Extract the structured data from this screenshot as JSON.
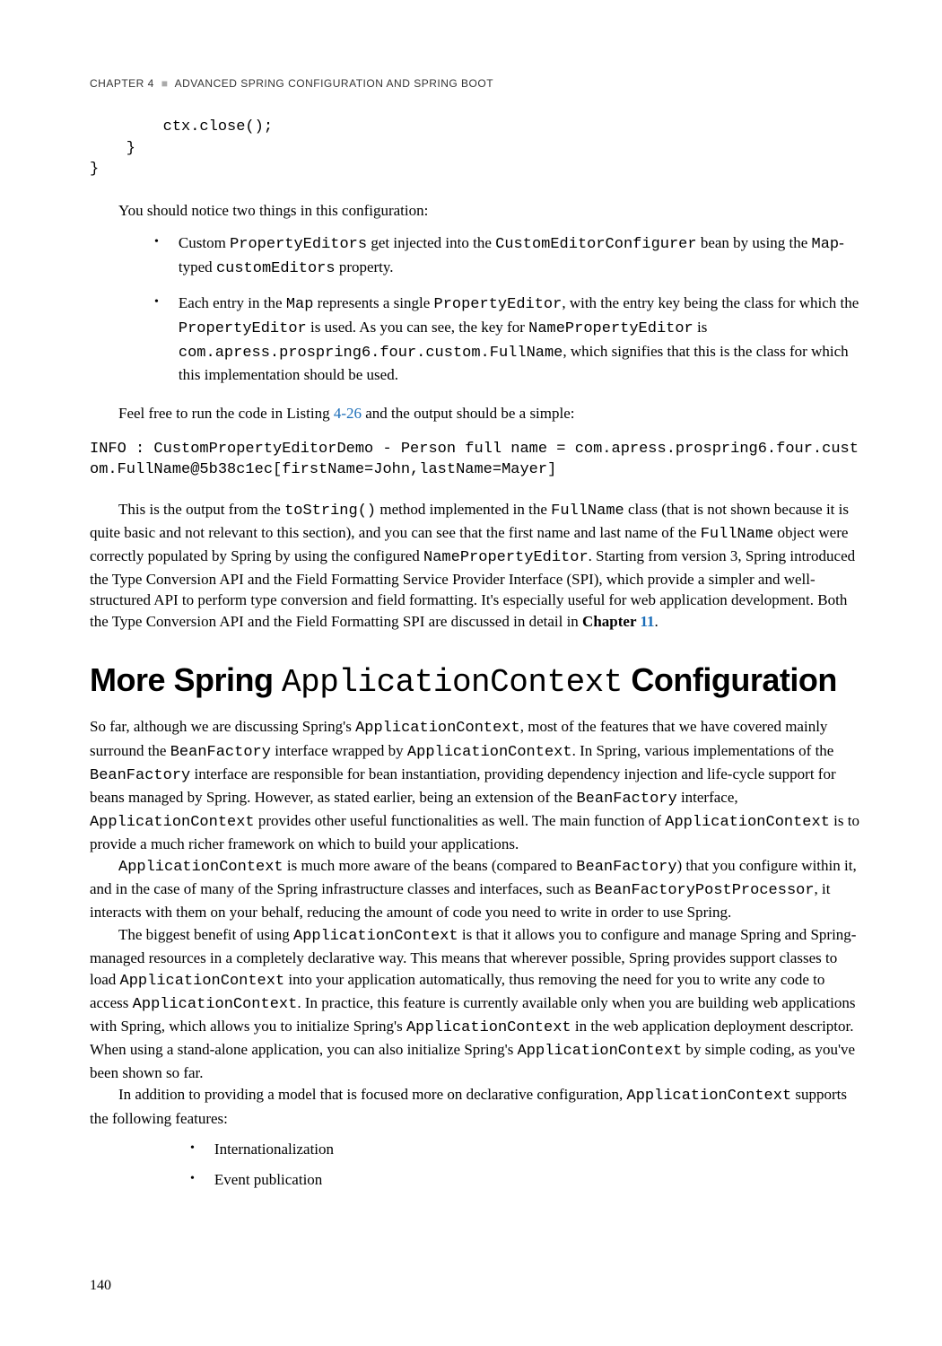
{
  "header": {
    "chapter_label": "CHAPTER 4",
    "separator": "■",
    "chapter_title": "ADVANCED SPRING CONFIGURATION AND SPRING BOOT"
  },
  "code_block": "        ctx.close();\n    }\n}",
  "intro_para": "You should notice two things in this configuration:",
  "bullets1": [
    {
      "pre1": "Custom ",
      "m1": "PropertyEditors",
      "mid1": " get injected into the ",
      "m2": "CustomEditorConfigurer",
      "mid2": " bean by using the ",
      "m3": "Map",
      "mid3": "-typed ",
      "m4": "customEditors",
      "end": " property."
    },
    {
      "pre1": "Each entry in the ",
      "m1": "Map",
      "mid1": " represents a single ",
      "m2": "PropertyEditor",
      "mid2": ", with the entry key being the class for which the ",
      "m3": "PropertyEditor",
      "mid3": " is used. As you can see, the key for ",
      "m4": "NamePropertyEditor",
      "mid4": " is ",
      "m5": "com.apress.prospring6.four.custom.FullName",
      "end": ", which signifies that this is the class for which this implementation should be used."
    }
  ],
  "listing_para": {
    "pre": "Feel free to run the code in Listing ",
    "link": "4-26",
    "post": " and the output should be a simple:"
  },
  "console": "INFO : CustomPropertyEditorDemo - Person full name = com.apress.prospring6.four.custom.FullName@5b38c1ec[firstName=John,lastName=Mayer]",
  "big_para": {
    "p1": "This is the output from the ",
    "m1": "toString()",
    "p2": " method implemented in the ",
    "m2": "FullName",
    "p3": " class (that is not shown because it is quite basic and not relevant to this section), and you can see that the first name and last name of the ",
    "m3": "FullName",
    "p4": " object were correctly populated by Spring by using the configured ",
    "m4": "NamePropertyEditor",
    "p5": ". Starting from version 3, Spring introduced the Type Conversion API and the Field Formatting Service Provider Interface (SPI), which provide a simpler and well-structured API to perform type conversion and field formatting. It's especially useful for web application development. Both the Type Conversion API and the Field Formatting SPI are discussed in detail in ",
    "bold": "Chapter ",
    "link": "11",
    "p6": "."
  },
  "section_heading": {
    "pre": "More Spring ",
    "mono": "ApplicationContext",
    "post": " Configuration"
  },
  "body": {
    "p1": {
      "t1": "So far, although we are discussing Spring's ",
      "m1": "ApplicationContext",
      "t2": ", most of the features that we have covered mainly surround the ",
      "m2": "BeanFactory",
      "t3": " interface wrapped by ",
      "m3": "ApplicationContext",
      "t4": ". In Spring, various implementations of the ",
      "m4": "BeanFactory",
      "t5": " interface are responsible for bean instantiation, providing dependency injection and life-cycle support for beans managed by Spring. However, as stated earlier, being an extension of the ",
      "m5": "BeanFactory",
      "t6": " interface, ",
      "m6": "ApplicationContext",
      "t7": " provides other useful functionalities as well. The main function of ",
      "m7": "ApplicationContext",
      "t8": " is to provide a much richer framework on which to build your applications."
    },
    "p2": {
      "m1": "ApplicationContext",
      "t1": " is much more aware of the beans (compared to ",
      "m2": "BeanFactory",
      "t2": ") that you configure within it, and in the case of many of the Spring infrastructure classes and interfaces, such as ",
      "m3": "BeanFactoryPostProcessor",
      "t3": ", it interacts with them on your behalf, reducing the amount of code you need to write in order to use Spring."
    },
    "p3": {
      "t1": "The biggest benefit of using ",
      "m1": "ApplicationContext",
      "t2": " is that it allows you to configure and manage Spring and Spring-managed resources in a completely declarative way. This means that wherever possible, Spring provides support classes to load ",
      "m2": "ApplicationContext",
      "t3": " into your application automatically, thus removing the need for you to write any code to access ",
      "m3": "ApplicationContext",
      "t4": ". In practice, this feature is currently available only when you are building web applications with Spring, which allows you to initialize Spring's ",
      "m4": "ApplicationContext",
      "t5": " in the web application deployment descriptor. When using a stand-alone application, you can also initialize Spring's ",
      "m5": "ApplicationContext",
      "t6": " by simple coding, as you've been shown so far."
    },
    "p4": {
      "t1": "In addition to providing a model that is focused more on declarative configuration, ",
      "m1": "ApplicationContext",
      "t2": " supports the following features:"
    }
  },
  "bullets2": [
    "Internationalization",
    "Event publication"
  ],
  "page_number": "140"
}
